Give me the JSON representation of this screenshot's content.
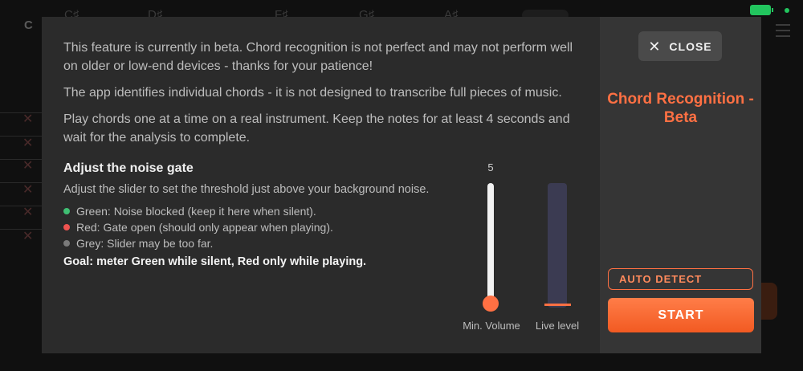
{
  "background": {
    "chord_labels": [
      "C♯",
      "D♯",
      "F♯",
      "G♯",
      "A♯"
    ],
    "corner_label": "C"
  },
  "content": {
    "paragraphs": [
      "This feature is currently in beta. Chord recognition is not perfect and may not perform well on older or low-end devices - thanks for your patience!",
      "The app identifies individual chords - it is not designed to transcribe full pieces of music.",
      "Play chords one at a time on a real instrument. Keep the notes for at least 4 seconds and wait for the analysis to complete."
    ],
    "noise_gate": {
      "title": "Adjust the noise gate",
      "instruction": "Adjust the slider to set the threshold just above your background noise.",
      "legend": [
        {
          "color": "#3fbf73",
          "text": "Green: Noise blocked (keep it here when silent)."
        },
        {
          "color": "#ef5350",
          "text": "Red: Gate open (should only appear when playing)."
        },
        {
          "color": "#7a7a7a",
          "text": "Grey: Slider may be too far."
        }
      ],
      "goal": "Goal: meter Green while silent, Red only while playing."
    },
    "slider": {
      "value": "5",
      "label": "Min. Volume"
    },
    "meter": {
      "label": "Live level"
    }
  },
  "side_panel": {
    "close_label": "CLOSE",
    "close_icon": "close-icon",
    "title": "Chord Recognition - Beta",
    "auto_detect_label": "AUTO DETECT",
    "start_label": "START"
  },
  "colors": {
    "accent": "#ff7043",
    "modal_bg": "#2b2b2b",
    "side_bg": "#353535",
    "battery": "#22c55e"
  }
}
